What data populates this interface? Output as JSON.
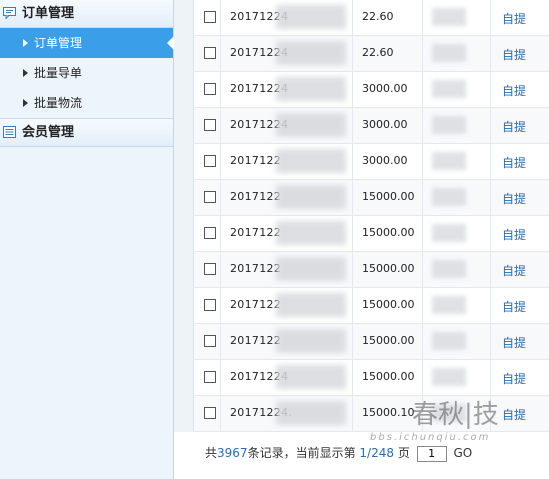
{
  "sidebar": {
    "groups": [
      {
        "title": "订单管理",
        "items": [
          {
            "label": "订单管理",
            "active": true
          },
          {
            "label": "批量导单",
            "active": false
          },
          {
            "label": "批量物流",
            "active": false
          }
        ]
      },
      {
        "title": "会员管理",
        "items": []
      }
    ]
  },
  "table": {
    "rows": [
      {
        "order": "20171224",
        "amount": "22.60",
        "action": "自提"
      },
      {
        "order": "20171224",
        "amount": "22.60",
        "action": "自提"
      },
      {
        "order": "20171224",
        "amount": "3000.00",
        "action": "自提"
      },
      {
        "order": "20171224",
        "amount": "3000.00",
        "action": "自提"
      },
      {
        "order": "2017122",
        "amount": "3000.00",
        "action": "自提"
      },
      {
        "order": "2017122",
        "amount": "15000.00",
        "action": "自提"
      },
      {
        "order": "2017122",
        "amount": "15000.00",
        "action": "自提"
      },
      {
        "order": "2017122",
        "amount": "15000.00",
        "action": "自提"
      },
      {
        "order": "2017122",
        "amount": "15000.00",
        "action": "自提"
      },
      {
        "order": "2017122",
        "amount": "15000.00",
        "action": "自提"
      },
      {
        "order": "20171224",
        "amount": "15000.00",
        "action": "自提"
      },
      {
        "order": "20171224.",
        "amount": "15000.10",
        "action": "自提"
      }
    ]
  },
  "pager": {
    "prefix": "共",
    "total": "3967",
    "mid": "条记录，当前显示第",
    "page": "1/248",
    "page_suffix": "页",
    "jump_value": "1",
    "go_label": "GO"
  },
  "watermark": {
    "text": "春秋|技",
    "url": "bbs.ichunqiu.com"
  },
  "colors": {
    "active_bg": "#3b9ee8",
    "link": "#2a6cb0",
    "sidebar_bg": "#edf5fc"
  }
}
